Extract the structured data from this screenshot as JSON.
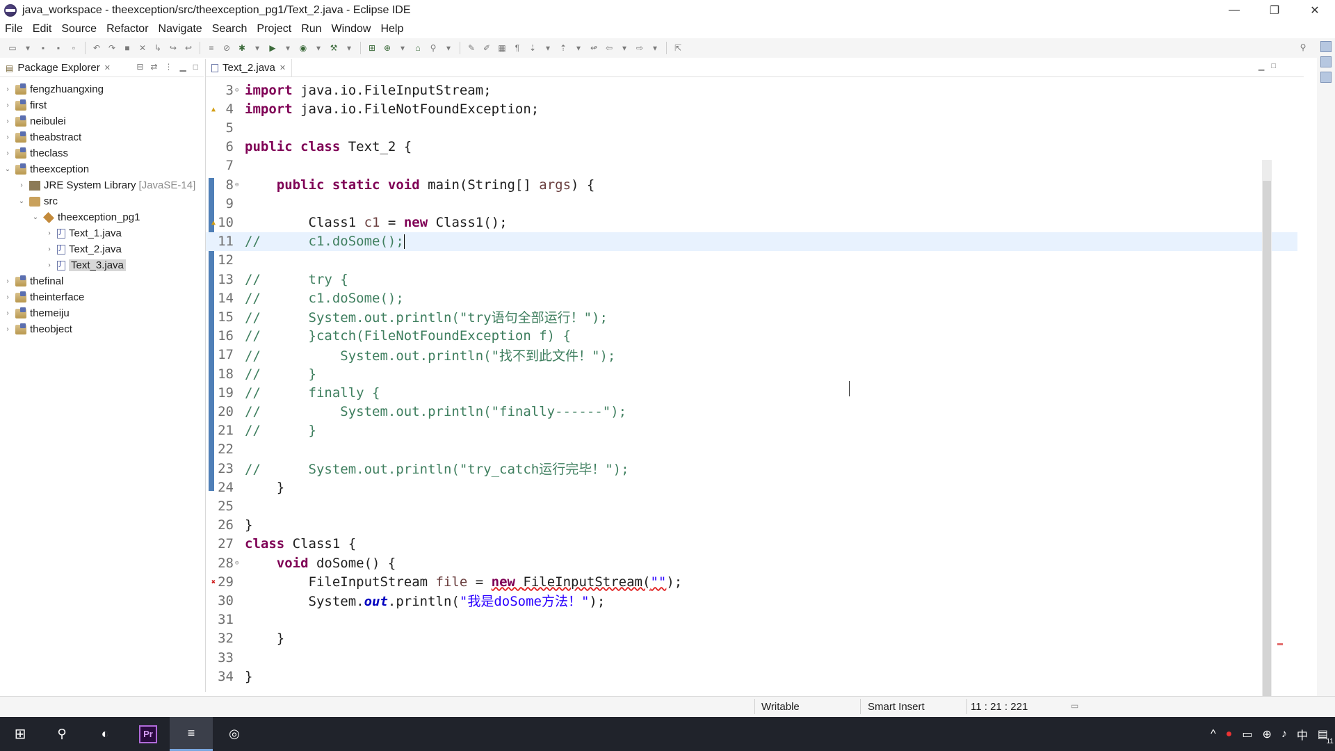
{
  "window": {
    "title": "java_workspace - theexception/src/theexception_pg1/Text_2.java - Eclipse IDE",
    "minimize": "—",
    "restore": "❐",
    "close": "✕"
  },
  "menu": [
    "File",
    "Edit",
    "Source",
    "Refactor",
    "Navigate",
    "Search",
    "Project",
    "Run",
    "Window",
    "Help"
  ],
  "explorer": {
    "title": "Package Explorer",
    "close": "✕",
    "tree": [
      {
        "label": "fengzhuangxing",
        "level": 0,
        "kind": "project",
        "expanded": false
      },
      {
        "label": "first",
        "level": 0,
        "kind": "project",
        "expanded": false
      },
      {
        "label": "neibulei",
        "level": 0,
        "kind": "project",
        "expanded": false
      },
      {
        "label": "theabstract",
        "level": 0,
        "kind": "project",
        "expanded": false
      },
      {
        "label": "theclass",
        "level": 0,
        "kind": "project",
        "expanded": false
      },
      {
        "label": "theexception",
        "level": 0,
        "kind": "project",
        "expanded": true
      },
      {
        "label": "JRE System Library",
        "suffix": "[JavaSE-14]",
        "level": 1,
        "kind": "library",
        "expanded": false
      },
      {
        "label": "src",
        "level": 1,
        "kind": "src",
        "expanded": true
      },
      {
        "label": "theexception_pg1",
        "level": 2,
        "kind": "package",
        "expanded": true
      },
      {
        "label": "Text_1.java",
        "level": 3,
        "kind": "java",
        "expanded": false
      },
      {
        "label": "Text_2.java",
        "level": 3,
        "kind": "java",
        "expanded": false
      },
      {
        "label": "Text_3.java",
        "level": 3,
        "kind": "java",
        "expanded": false,
        "selected": true
      },
      {
        "label": "thefinal",
        "level": 0,
        "kind": "project",
        "expanded": false
      },
      {
        "label": "theinterface",
        "level": 0,
        "kind": "project",
        "expanded": false
      },
      {
        "label": "themeiju",
        "level": 0,
        "kind": "project",
        "expanded": false
      },
      {
        "label": "theobject",
        "level": 0,
        "kind": "project",
        "expanded": false
      }
    ]
  },
  "editor": {
    "tab_label": "Text_2.java",
    "tab_close": "✕",
    "current_line": 11,
    "lines": [
      {
        "n": "3",
        "fold": "⊖",
        "tokens": [
          [
            "kw",
            "import"
          ],
          [
            "",
            "java.io.FileInputStream;"
          ]
        ]
      },
      {
        "n": "4",
        "mark": "warn",
        "tokens": [
          [
            "kw",
            "import"
          ],
          [
            "",
            "java.io.FileNotFoundException;"
          ]
        ]
      },
      {
        "n": "5",
        "tokens": []
      },
      {
        "n": "6",
        "tokens": [
          [
            "kw",
            "public"
          ],
          [
            "kw",
            "class"
          ],
          [
            "",
            "Text_2 {"
          ]
        ]
      },
      {
        "n": "7",
        "tokens": []
      },
      {
        "n": "8",
        "fold": "⊖",
        "tokens": [
          [
            "",
            "    "
          ],
          [
            "kw",
            "public"
          ],
          [
            "kw",
            "static"
          ],
          [
            "kw",
            "void"
          ],
          [
            "",
            "main(String[] "
          ],
          [
            "var",
            "args"
          ],
          [
            "",
            ") {"
          ]
        ]
      },
      {
        "n": "9",
        "tokens": []
      },
      {
        "n": "10",
        "mark": "warn",
        "tokens": [
          [
            "",
            "        Class1 "
          ],
          [
            "var",
            "c1"
          ],
          [
            "",
            " = "
          ],
          [
            "kw",
            "new"
          ],
          [
            "",
            "Class1();"
          ]
        ]
      },
      {
        "n": "11",
        "tokens": [
          [
            "cm",
            "//      c1.doSome();"
          ]
        ],
        "caret": true
      },
      {
        "n": "12",
        "tokens": []
      },
      {
        "n": "13",
        "tokens": [
          [
            "cm",
            "//      try {"
          ]
        ]
      },
      {
        "n": "14",
        "tokens": [
          [
            "cm",
            "//      c1.doSome();"
          ]
        ]
      },
      {
        "n": "15",
        "tokens": [
          [
            "cm",
            "//      System.out.println(\"try语句全部运行！\");"
          ]
        ]
      },
      {
        "n": "16",
        "tokens": [
          [
            "cm",
            "//      }catch(FileNotFoundException f) {"
          ]
        ]
      },
      {
        "n": "17",
        "tokens": [
          [
            "cm",
            "//          System.out.println(\"找不到此文件！\");"
          ]
        ]
      },
      {
        "n": "18",
        "tokens": [
          [
            "cm",
            "//      }"
          ]
        ]
      },
      {
        "n": "19",
        "tokens": [
          [
            "cm",
            "//      finally {"
          ]
        ]
      },
      {
        "n": "20",
        "tokens": [
          [
            "cm",
            "//          System.out.println(\"finally------\");"
          ]
        ]
      },
      {
        "n": "21",
        "tokens": [
          [
            "cm",
            "//      }"
          ]
        ]
      },
      {
        "n": "22",
        "tokens": []
      },
      {
        "n": "23",
        "tokens": [
          [
            "cm",
            "//      System.out.println(\"try_catch运行完毕！\");"
          ]
        ]
      },
      {
        "n": "24",
        "tokens": [
          [
            "",
            "    }"
          ]
        ]
      },
      {
        "n": "25",
        "tokens": []
      },
      {
        "n": "26",
        "tokens": [
          [
            "",
            "}"
          ]
        ]
      },
      {
        "n": "27",
        "tokens": [
          [
            "kw",
            "class"
          ],
          [
            "",
            "Class1 {"
          ]
        ]
      },
      {
        "n": "28",
        "fold": "⊖",
        "tokens": [
          [
            "",
            "    "
          ],
          [
            "kw",
            "void"
          ],
          [
            "",
            "doSome() {"
          ]
        ]
      },
      {
        "n": "29",
        "mark": "err",
        "tokens": [
          [
            "",
            "        FileInputStream "
          ],
          [
            "var",
            "file"
          ],
          [
            "",
            " = "
          ],
          [
            "kw err",
            "new"
          ],
          [
            "err",
            "FileInputStream("
          ],
          [
            "str err",
            "\"\""
          ],
          [
            "",
            ");"
          ]
        ]
      },
      {
        "n": "30",
        "tokens": [
          [
            "",
            "        System."
          ],
          [
            "fld",
            "out"
          ],
          [
            "",
            ".println("
          ],
          [
            "str",
            "\"我是doSome方法！\""
          ],
          [
            "",
            ");"
          ]
        ]
      },
      {
        "n": "31",
        "tokens": []
      },
      {
        "n": "32",
        "tokens": [
          [
            "",
            "    }"
          ]
        ]
      },
      {
        "n": "33",
        "tokens": []
      },
      {
        "n": "34",
        "tokens": [
          [
            "",
            "}"
          ]
        ]
      }
    ]
  },
  "status": {
    "writable": "Writable",
    "insert_mode": "Smart Insert",
    "position": "11 : 21 : 221"
  },
  "taskbar": {
    "start_icon": "windows-logo",
    "items": [
      "search",
      "browser",
      "Pr",
      "eclipse",
      "obs"
    ],
    "ime": "中",
    "notification_count": "11"
  }
}
